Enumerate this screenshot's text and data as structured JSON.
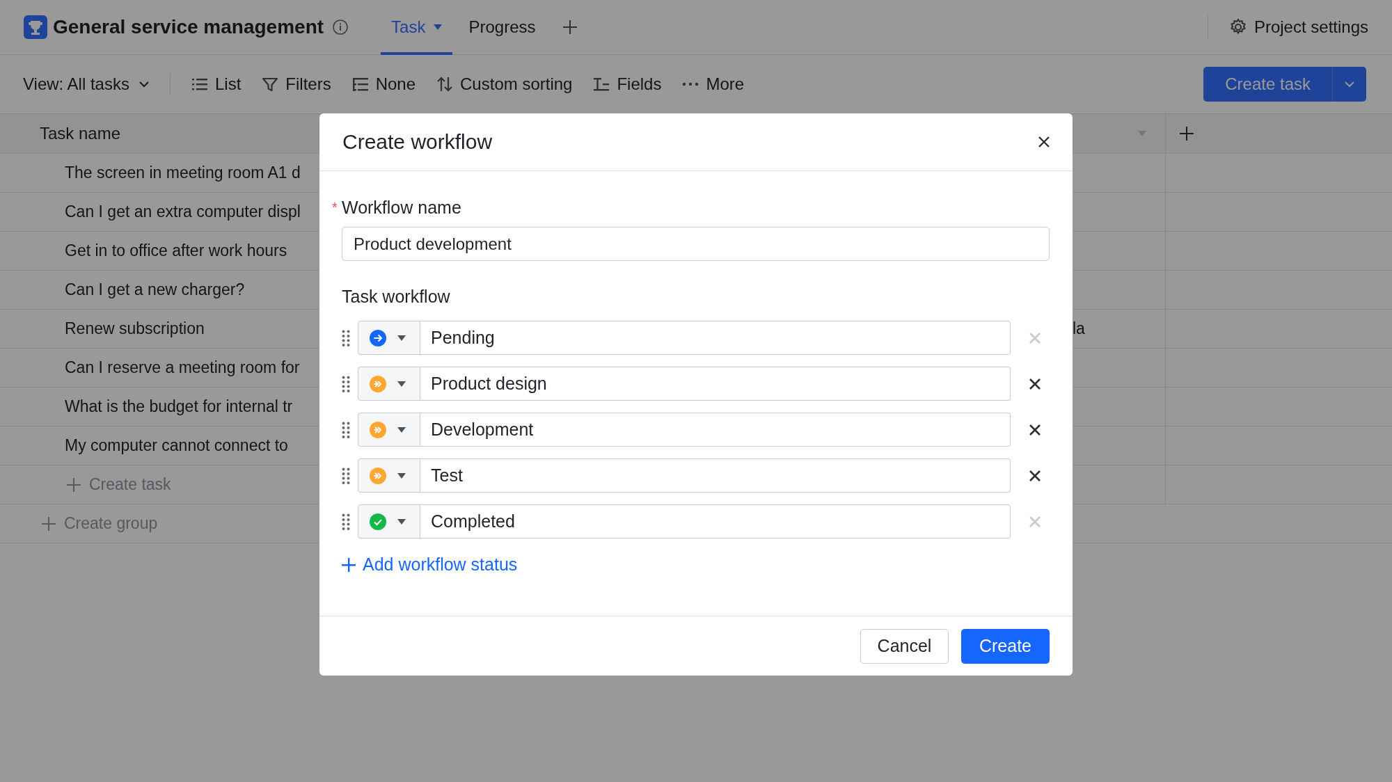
{
  "app": {
    "title": "General service management"
  },
  "tabs": [
    {
      "label": "Task",
      "selected": true
    },
    {
      "label": "Progress",
      "selected": false
    }
  ],
  "settings_link": "Project settings",
  "toolbar": {
    "view": "View: All tasks",
    "items": [
      {
        "kind": "list",
        "label": "List"
      },
      {
        "kind": "filter",
        "label": "Filters"
      },
      {
        "kind": "group",
        "label": "None"
      },
      {
        "kind": "sort",
        "label": "Custom sorting"
      },
      {
        "kind": "fields",
        "label": "Fields"
      },
      {
        "kind": "more",
        "label": "More"
      }
    ],
    "create_button": "Create task"
  },
  "table": {
    "columns": [
      "Task name"
    ],
    "rows": [
      {
        "task": "The screen in meeting room A1 d"
      },
      {
        "task": "Can I get an extra computer displ"
      },
      {
        "task": "Get in to office after work hours"
      },
      {
        "task": "Can I get a new charger?"
      },
      {
        "task": "Renew subscription",
        "column_2": "la"
      },
      {
        "task": "Can I reserve a meeting room for"
      },
      {
        "task": "What is the budget for internal tr"
      },
      {
        "task": "My computer cannot connect to"
      }
    ],
    "add_task": "Create task",
    "add_group": "Create group"
  },
  "dialog": {
    "title": "Create workflow",
    "required_mark": "*",
    "name_label": "Workflow name",
    "name_value": "Product development",
    "workflow_label": "Task workflow",
    "statuses": [
      {
        "kind": "start",
        "name": "Pending",
        "removable": false
      },
      {
        "kind": "progress",
        "name": "Product design",
        "removable": true
      },
      {
        "kind": "progress",
        "name": "Development",
        "removable": true
      },
      {
        "kind": "progress",
        "name": "Test",
        "removable": true
      },
      {
        "kind": "done",
        "name": "Completed",
        "removable": false
      }
    ],
    "add_status": "Add workflow status",
    "cancel": "Cancel",
    "create": "Create"
  }
}
